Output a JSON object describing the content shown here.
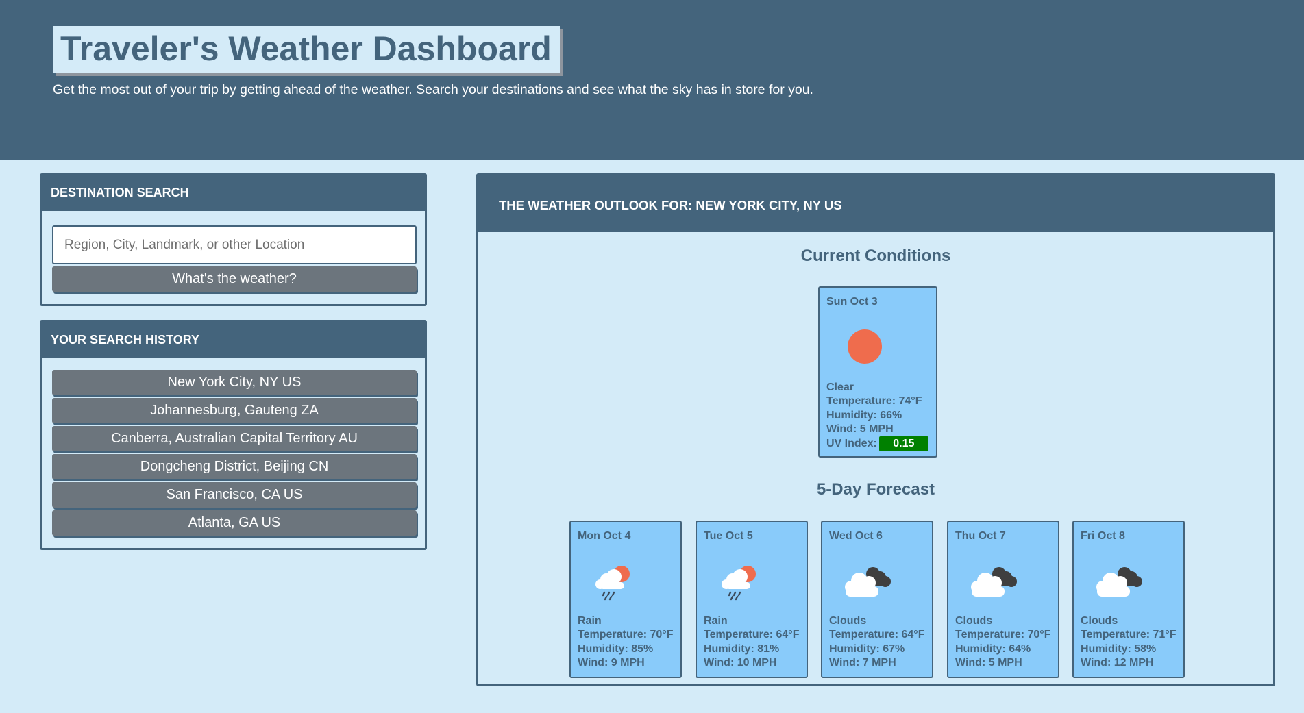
{
  "header": {
    "title": "Traveler's Weather Dashboard",
    "subtitle": "Get the most out of your trip by getting ahead of the weather. Search your destinations and see what the sky has in store for you."
  },
  "search": {
    "heading": "Destination Search",
    "placeholder": "Region, City, Landmark, or other Location",
    "button_label": "What's the weather?"
  },
  "history": {
    "heading": "Your Search History",
    "items": [
      "New York City, NY US",
      "Johannesburg, Gauteng ZA",
      "Canberra, Australian Capital Territory AU",
      "Dongcheng District, Beijing CN",
      "San Francisco, CA US",
      "Atlanta, GA US"
    ]
  },
  "outlook": {
    "heading": "The Weather Outlook For: New York City, NY US",
    "current_title": "Current Conditions",
    "forecast_title": "5-Day Forecast",
    "current": {
      "date": "Sun Oct 3",
      "icon": "sun-icon",
      "condition": "Clear",
      "temperature": "Temperature: 74°F",
      "humidity": "Humidity: 66%",
      "wind": "Wind: 5 MPH",
      "uv_label": "UV Index:",
      "uv_value": "0.15",
      "uv_color": "#008000"
    },
    "forecast": [
      {
        "date": "Mon Oct 4",
        "icon": "rain-icon",
        "condition": "Rain",
        "temperature": "Temperature: 70°F",
        "humidity": "Humidity: 85%",
        "wind": "Wind: 9 MPH"
      },
      {
        "date": "Tue Oct 5",
        "icon": "rain-icon",
        "condition": "Rain",
        "temperature": "Temperature: 64°F",
        "humidity": "Humidity: 81%",
        "wind": "Wind: 10 MPH"
      },
      {
        "date": "Wed Oct 6",
        "icon": "clouds-icon",
        "condition": "Clouds",
        "temperature": "Temperature: 64°F",
        "humidity": "Humidity: 67%",
        "wind": "Wind: 7 MPH"
      },
      {
        "date": "Thu Oct 7",
        "icon": "clouds-icon",
        "condition": "Clouds",
        "temperature": "Temperature: 70°F",
        "humidity": "Humidity: 64%",
        "wind": "Wind: 5 MPH"
      },
      {
        "date": "Fri Oct 8",
        "icon": "clouds-icon",
        "condition": "Clouds",
        "temperature": "Temperature: 71°F",
        "humidity": "Humidity: 58%",
        "wind": "Wind: 12 MPH"
      }
    ]
  },
  "colors": {
    "primary": "#44647c",
    "background": "#d4ebf8",
    "card": "#89cbfa",
    "button": "#6c757d",
    "sun": "#ef6c4d"
  }
}
